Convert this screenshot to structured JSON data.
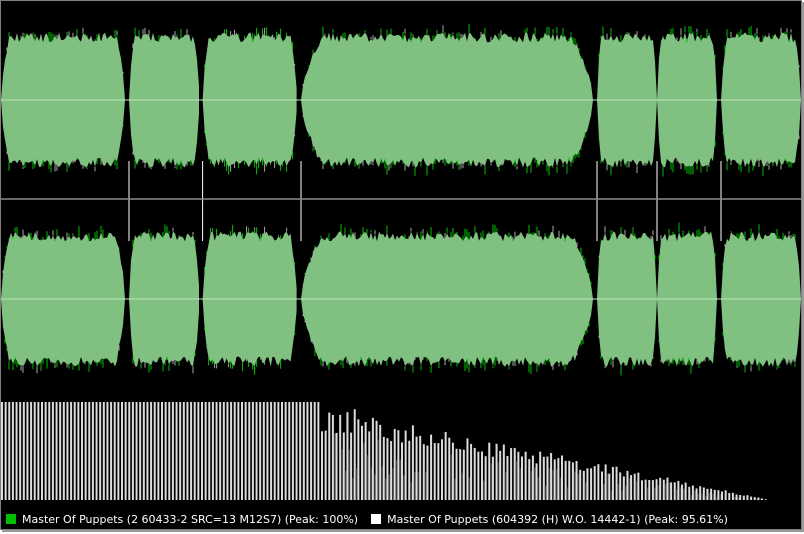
{
  "legend": [
    {
      "label": "Master Of Puppets (2 60433-2 SRC=13 M12S7) (Peak: 100%)",
      "color": "#00c000"
    },
    {
      "label": "Master Of Puppets (604392 (H) W.O. 14442-1) (Peak: 95.61%)",
      "color": "#ffffff"
    }
  ],
  "colors": {
    "background": "#000000",
    "fill": "#80c080",
    "center_line": "#c0e4c0",
    "peak_a": "#00c000",
    "peak_b": "#a8a8a8",
    "histogram": "#dcdcdc"
  },
  "chart_data": {
    "type": "area",
    "channels": [
      "left",
      "right"
    ],
    "segments": [
      {
        "start": 0.0,
        "end": 0.155
      },
      {
        "start": 0.16,
        "end": 0.248
      },
      {
        "start": 0.252,
        "end": 0.37
      },
      {
        "start": 0.375,
        "end": 0.74
      },
      {
        "start": 0.745,
        "end": 0.82
      },
      {
        "start": 0.82,
        "end": 0.895
      },
      {
        "start": 0.9,
        "end": 1.0
      }
    ],
    "peaks": {
      "series_a": 1.0,
      "series_b": 0.9561
    },
    "histogram": {
      "bins": 220,
      "flat_until": 0.4,
      "flat_level": 1.0,
      "dark_from": 0.4,
      "tail_end": 0.96
    }
  }
}
